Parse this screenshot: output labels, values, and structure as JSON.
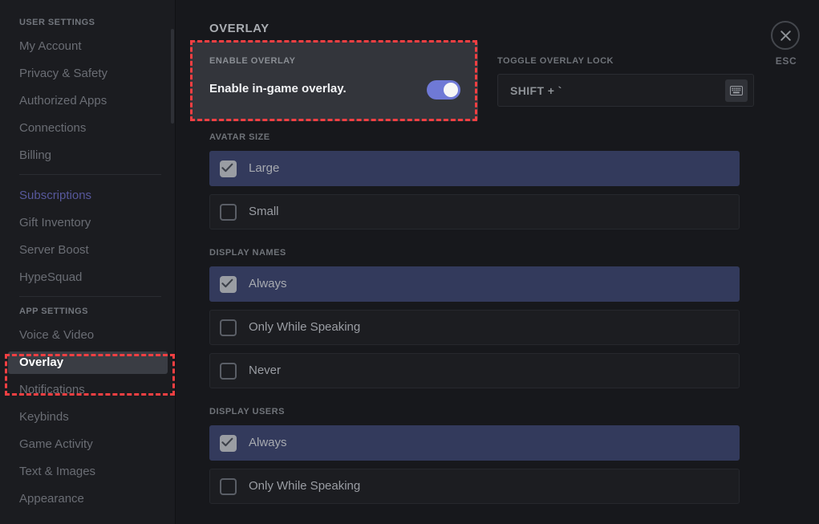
{
  "window": {
    "close": {
      "label": "ESC",
      "icon": "close-icon"
    }
  },
  "sidebar": {
    "user_settings_header": "User Settings",
    "user_items": [
      {
        "label": "My Account"
      },
      {
        "label": "Privacy & Safety"
      },
      {
        "label": "Authorized Apps"
      },
      {
        "label": "Connections"
      },
      {
        "label": "Billing"
      }
    ],
    "billing_items": [
      {
        "label": "Subscriptions"
      },
      {
        "label": "Gift Inventory"
      },
      {
        "label": "Server Boost"
      },
      {
        "label": "HypeSquad"
      }
    ],
    "app_settings_header": "App Settings",
    "app_items": [
      {
        "label": "Voice & Video",
        "active": false
      },
      {
        "label": "Overlay",
        "active": true
      },
      {
        "label": "Notifications",
        "active": false
      },
      {
        "label": "Keybinds",
        "active": false
      },
      {
        "label": "Game Activity",
        "active": false
      },
      {
        "label": "Text & Images",
        "active": false
      },
      {
        "label": "Appearance",
        "active": false
      }
    ]
  },
  "main": {
    "title": "Overlay",
    "enable_card": {
      "label": "Enable Overlay",
      "text": "Enable in-game overlay.",
      "toggle_on": true
    },
    "keybind": {
      "label": "Toggle Overlay Lock",
      "value": "SHIFT + `",
      "icon": "keyboard-icon"
    },
    "groups": [
      {
        "label": "Avatar Size",
        "options": [
          {
            "label": "Large",
            "selected": true
          },
          {
            "label": "Small",
            "selected": false
          }
        ]
      },
      {
        "label": "Display Names",
        "options": [
          {
            "label": "Always",
            "selected": true
          },
          {
            "label": "Only While Speaking",
            "selected": false
          },
          {
            "label": "Never",
            "selected": false
          }
        ]
      },
      {
        "label": "Display Users",
        "options": [
          {
            "label": "Always",
            "selected": true
          },
          {
            "label": "Only While Speaking",
            "selected": false
          }
        ]
      }
    ]
  },
  "annotations": {
    "sidebar_highlight": "overlay-menu-item",
    "card_highlight": "enable-overlay-card"
  },
  "colors": {
    "accent_toggle": "#6f79d6",
    "selected_row": "#333a5c",
    "annotation": "#f23f42",
    "link": "#57589c"
  }
}
